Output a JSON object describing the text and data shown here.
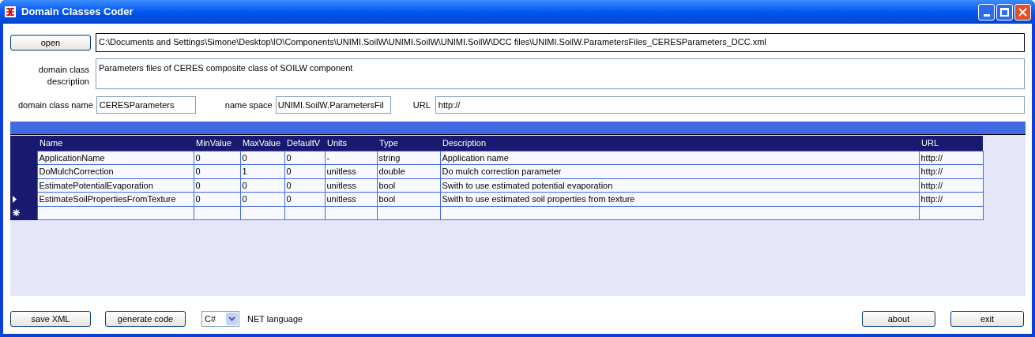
{
  "window": {
    "title": "Domain Classes Coder"
  },
  "open_button": "open",
  "file_path": "C:\\Documents and Settings\\Simone\\Desktop\\IO\\Components\\UNIMI.SoilW\\UNIMI.SoilW\\UNIMI.SoilW\\DCC files\\UNIMI.SoilW.ParametersFiles_CERESParameters_DCC.xml",
  "description": {
    "label": "domain class description",
    "value": "Parameters files of CERES composite class of SOILW component"
  },
  "class_name": {
    "label": "domain class name",
    "value": "CERESParameters"
  },
  "name_space": {
    "label": "name space",
    "value": "UNIMI.SoilW.ParametersFil"
  },
  "url": {
    "label": "URL",
    "value": "http://"
  },
  "table": {
    "columns": [
      "Name",
      "MinValue",
      "MaxValue",
      "DefaultV",
      "Units",
      "Type",
      "Description",
      "URL"
    ],
    "rows": [
      {
        "kind": "data",
        "current": false,
        "cells": [
          "ApplicationName",
          "0",
          "0",
          "0",
          "-",
          "string",
          "Application name",
          "http://"
        ]
      },
      {
        "kind": "data",
        "current": false,
        "cells": [
          "DoMulchCorrection",
          "0",
          "1",
          "0",
          "unitless",
          "double",
          "Do mulch correction parameter",
          "http://"
        ]
      },
      {
        "kind": "data",
        "current": false,
        "cells": [
          "EstimatePotentialEvaporation",
          "0",
          "0",
          "0",
          "unitless",
          "bool",
          "Swith to use estimated potential evaporation",
          "http://"
        ]
      },
      {
        "kind": "data",
        "current": true,
        "cells": [
          "EstimateSoilPropertiesFromTexture",
          "0",
          "0",
          "0",
          "unitless",
          "bool",
          "Swith to use estimated soil properties from texture",
          "http://"
        ]
      },
      {
        "kind": "new",
        "current": false
      }
    ]
  },
  "buttons_left": [
    "save XML",
    "generate code"
  ],
  "language": {
    "value": "C#",
    "label": "NET language"
  },
  "buttons_right": [
    "about",
    "exit"
  ]
}
